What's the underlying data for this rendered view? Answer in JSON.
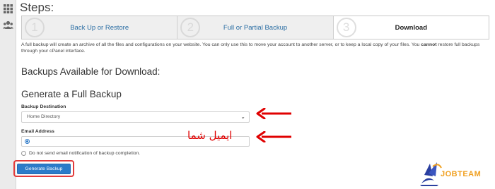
{
  "page": {
    "heading": "Steps:",
    "steps": [
      {
        "number": "1",
        "label": "Back Up or Restore"
      },
      {
        "number": "2",
        "label": "Full or Partial Backup"
      },
      {
        "number": "3",
        "label": "Download"
      }
    ],
    "description_part1": "A full backup will create an archive of all the files and configurations on your website. You can only use this to move your account to another server, or to keep a local copy of your files. You ",
    "description_bold": "cannot",
    "description_part2": " restore full backups through your cPanel interface.",
    "backups_available_title": "Backups Available for Download:",
    "generate_title": "Generate a Full Backup",
    "destination_label": "Backup Destination",
    "destination_value": "Home Directory",
    "email_label": "Email Address",
    "no_email_option": "Do not send email notification of backup completion.",
    "generate_button": "Generate Backup"
  },
  "annotations": {
    "email_hint": "ایمیل شما",
    "watermark": "JOBTEAM",
    "arrow_color": "#e00000",
    "highlight_color": "#e23b3b"
  },
  "icons": {
    "rail": [
      "apps-grid-icon",
      "users-icon"
    ]
  },
  "colors": {
    "accent": "#2b7bc9",
    "link": "#2a6da3",
    "logo_orange": "#f0a020",
    "logo_blue": "#2a3fa0"
  }
}
